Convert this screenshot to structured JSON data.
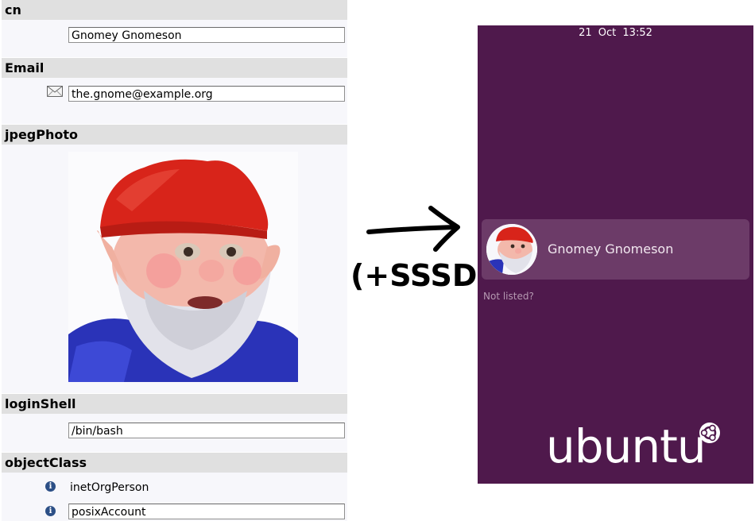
{
  "ldap": {
    "attributes": [
      {
        "name": "cn",
        "value": "Gnomey Gnomeson"
      },
      {
        "name": "Email",
        "value": "the.gnome@example.org",
        "icon": "mail-icon"
      },
      {
        "name": "jpegPhoto"
      },
      {
        "name": "loginShell",
        "value": "/bin/bash"
      },
      {
        "name": "objectClass",
        "values": [
          "inetOrgPerson",
          "posixAccount"
        ],
        "icon": "info-icon"
      }
    ]
  },
  "annotation": {
    "text": "(+SSSD)",
    "arrow_icon": "arrow-right-icon"
  },
  "login_screen": {
    "date": "21 Oct",
    "time": "13:52",
    "user_name": "Gnomey Gnomeson",
    "not_listed": "Not listed?",
    "brand": "ubuntu",
    "brand_icon": "circle-of-friends-icon",
    "background_color": "#4f194c"
  }
}
